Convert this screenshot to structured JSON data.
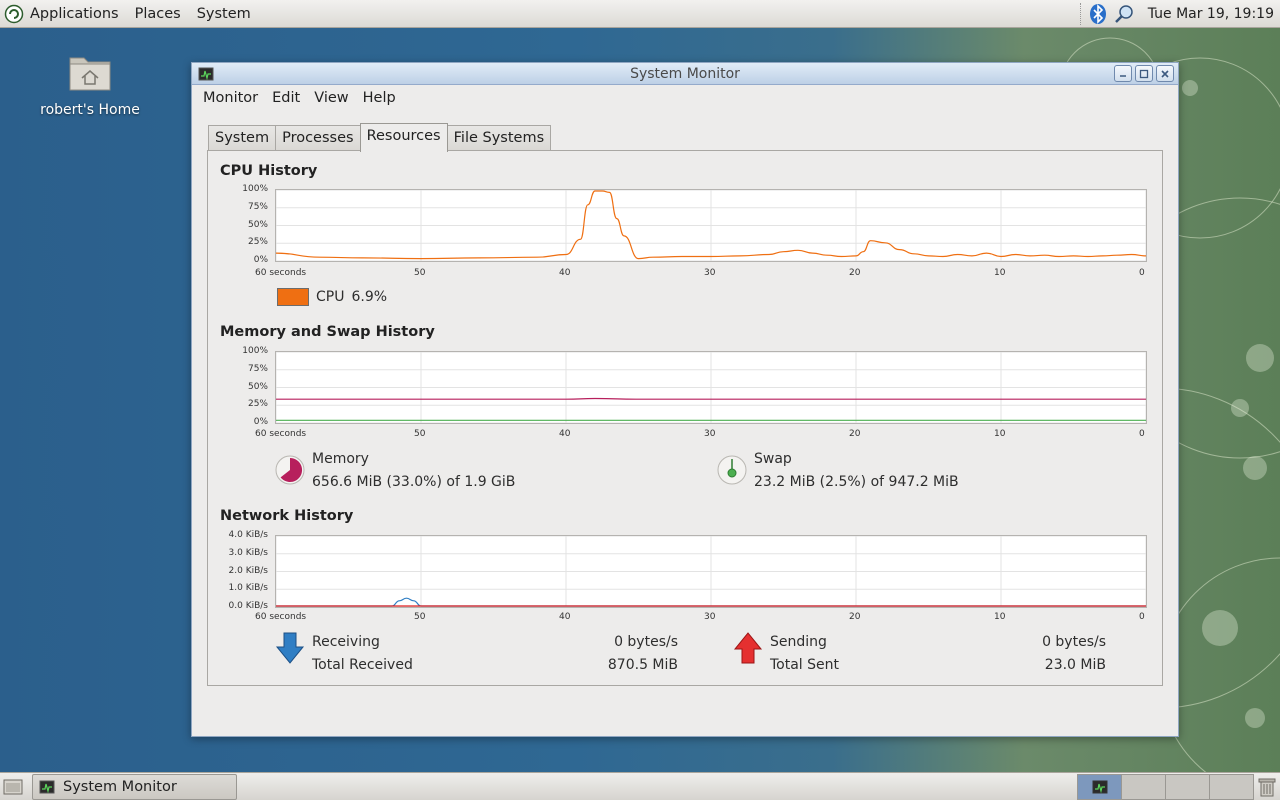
{
  "top_panel": {
    "menus": [
      "Applications",
      "Places",
      "System"
    ],
    "clock": "Tue Mar 19, 19:19",
    "tray_icons": [
      "bluetooth-icon",
      "network-search-icon"
    ]
  },
  "desktop": {
    "home_label": "robert's Home"
  },
  "window": {
    "title": "System Monitor",
    "menus": [
      "Monitor",
      "Edit",
      "View",
      "Help"
    ],
    "tabs": [
      "System",
      "Processes",
      "Resources",
      "File Systems"
    ],
    "active_tab": "Resources"
  },
  "cpu": {
    "title": "CPU History",
    "y_ticks": [
      "100%",
      "75%",
      "50%",
      "25%",
      "0%"
    ],
    "x_ticks": [
      "60 seconds",
      "50",
      "40",
      "30",
      "20",
      "10",
      "0"
    ],
    "legend_label": "CPU",
    "legend_value": "6.9%",
    "color": "#ef6f12"
  },
  "memory": {
    "title": "Memory and Swap History",
    "y_ticks": [
      "100%",
      "75%",
      "50%",
      "25%",
      "0%"
    ],
    "x_ticks": [
      "60 seconds",
      "50",
      "40",
      "30",
      "20",
      "10",
      "0"
    ],
    "mem_label": "Memory",
    "mem_value": "656.6 MiB (33.0%) of 1.9 GiB",
    "swap_label": "Swap",
    "swap_value": "23.2 MiB (2.5%) of 947.2 MiB",
    "mem_color": "#b71f5c",
    "swap_color": "#4caf50"
  },
  "network": {
    "title": "Network History",
    "y_ticks": [
      "4.0 KiB/s",
      "3.0 KiB/s",
      "2.0 KiB/s",
      "1.0 KiB/s",
      "0.0 KiB/s"
    ],
    "x_ticks": [
      "60 seconds",
      "50",
      "40",
      "30",
      "20",
      "10",
      "0"
    ],
    "receiving_label": "Receiving",
    "receiving_value": "0 bytes/s",
    "total_received_label": "Total Received",
    "total_received_value": "870.5 MiB",
    "sending_label": "Sending",
    "sending_value": "0 bytes/s",
    "total_sent_label": "Total Sent",
    "total_sent_value": "23.0 MiB",
    "recv_color": "#2f7ec4",
    "send_color": "#e02020"
  },
  "taskbar": {
    "task_label": "System Monitor"
  },
  "chart_data": [
    {
      "type": "line",
      "title": "CPU History",
      "x": [
        60,
        57,
        54,
        50,
        46,
        42,
        40,
        39,
        38.5,
        38,
        37.5,
        37,
        36.5,
        36,
        35,
        34,
        32,
        30,
        28,
        26,
        25,
        24,
        23,
        22,
        21,
        20,
        19.5,
        19,
        18,
        17,
        16,
        15,
        14,
        13,
        12,
        11,
        10,
        9,
        8,
        7,
        6,
        5,
        4,
        3,
        2,
        1,
        0
      ],
      "series": [
        {
          "name": "CPU",
          "values": [
            10,
            4,
            3,
            2,
            3,
            4,
            8,
            30,
            80,
            100,
            100,
            98,
            60,
            35,
            2,
            4,
            5,
            5,
            6,
            8,
            12,
            14,
            10,
            7,
            5,
            6,
            12,
            28,
            25,
            15,
            9,
            6,
            5,
            8,
            6,
            10,
            5,
            8,
            6,
            7,
            5,
            6,
            5,
            6,
            7,
            8,
            6
          ]
        }
      ],
      "xlabel": "",
      "ylabel": "",
      "ylim": [
        0,
        100
      ]
    },
    {
      "type": "line",
      "title": "Memory and Swap History",
      "x": [
        60,
        50,
        40,
        38,
        35,
        30,
        20,
        10,
        0
      ],
      "series": [
        {
          "name": "Memory",
          "values": [
            33,
            33,
            33,
            34,
            33,
            33,
            33,
            33,
            33
          ]
        },
        {
          "name": "Swap",
          "values": [
            2.5,
            2.5,
            2.5,
            2.5,
            2.5,
            2.5,
            2.5,
            2.5,
            2.5
          ]
        }
      ],
      "ylim": [
        0,
        100
      ]
    },
    {
      "type": "line",
      "title": "Network History",
      "x": [
        60,
        52,
        51.5,
        51,
        50.5,
        50,
        40,
        30,
        20,
        10,
        0
      ],
      "series": [
        {
          "name": "Receiving",
          "values": [
            0,
            0,
            0.3,
            0.45,
            0.3,
            0,
            0,
            0,
            0,
            0,
            0
          ]
        },
        {
          "name": "Sending",
          "values": [
            0,
            0,
            0,
            0,
            0,
            0,
            0,
            0,
            0,
            0,
            0
          ]
        }
      ],
      "ylim": [
        0,
        4
      ]
    }
  ]
}
